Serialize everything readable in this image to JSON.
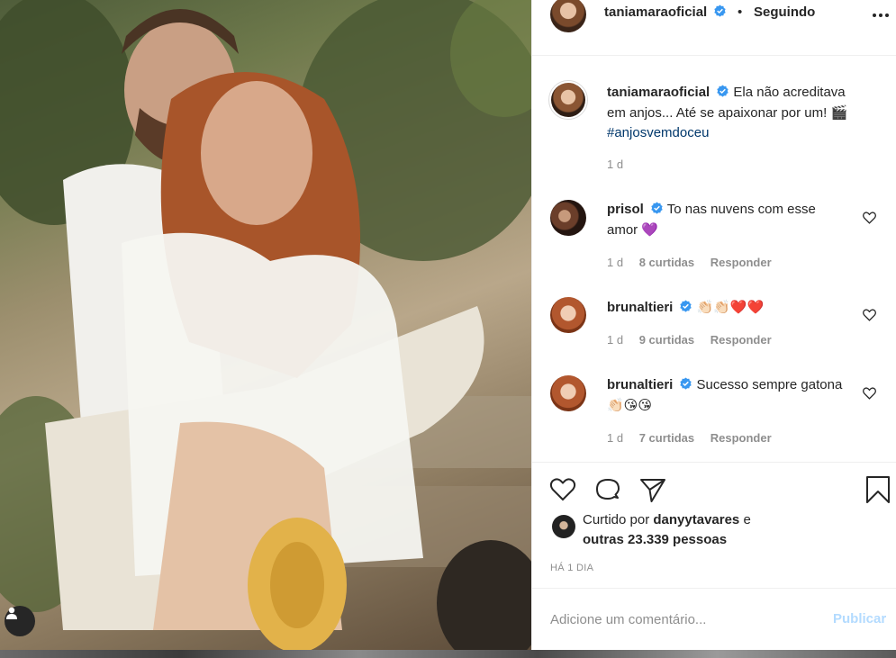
{
  "post": {
    "author": "taniamaraoficial",
    "follow_separator": "•",
    "follow_status": "Seguindo"
  },
  "caption": {
    "username": "taniamaraoficial",
    "text": "Ela não acreditava em anjos... Até se apaixonar por um!",
    "emoji": "🎬",
    "hashtag": "#anjosvemdoceu",
    "age": "1 d"
  },
  "comments": [
    {
      "username": "prisol",
      "verified": true,
      "text": "To nas nuvens com esse amor",
      "emoji": "💜",
      "age": "1 d",
      "likes": "8 curtidas",
      "reply": "Responder"
    },
    {
      "username": "brunaltieri",
      "verified": true,
      "text": "",
      "emoji": "👏🏻👏🏻❤️❤️",
      "age": "1 d",
      "likes": "9 curtidas",
      "reply": "Responder"
    },
    {
      "username": "brunaltieri",
      "verified": true,
      "text": "Sucesso sempre gatona",
      "emoji": "👏🏻😘😘",
      "age": "1 d",
      "likes": "7 curtidas",
      "reply": "Responder"
    }
  ],
  "likes": {
    "prefix": "Curtido por",
    "first_user": "danyytavares",
    "conjunction": "e",
    "others": "outras 23.339 pessoas"
  },
  "time_ago": "HÁ 1 DIA",
  "add_comment": {
    "placeholder": "Adicione um comentário...",
    "submit_label": "Publicar"
  },
  "colors": {
    "verified_blue": "#3897f0",
    "hashtag_blue": "#00376b",
    "publish_disabled": "#b3dbff",
    "muted_text": "#8e8e8e"
  },
  "icons": [
    "verified-badge-icon",
    "more-options-icon",
    "heart-icon",
    "comment-icon",
    "share-icon",
    "bookmark-icon",
    "user-tag-icon"
  ]
}
